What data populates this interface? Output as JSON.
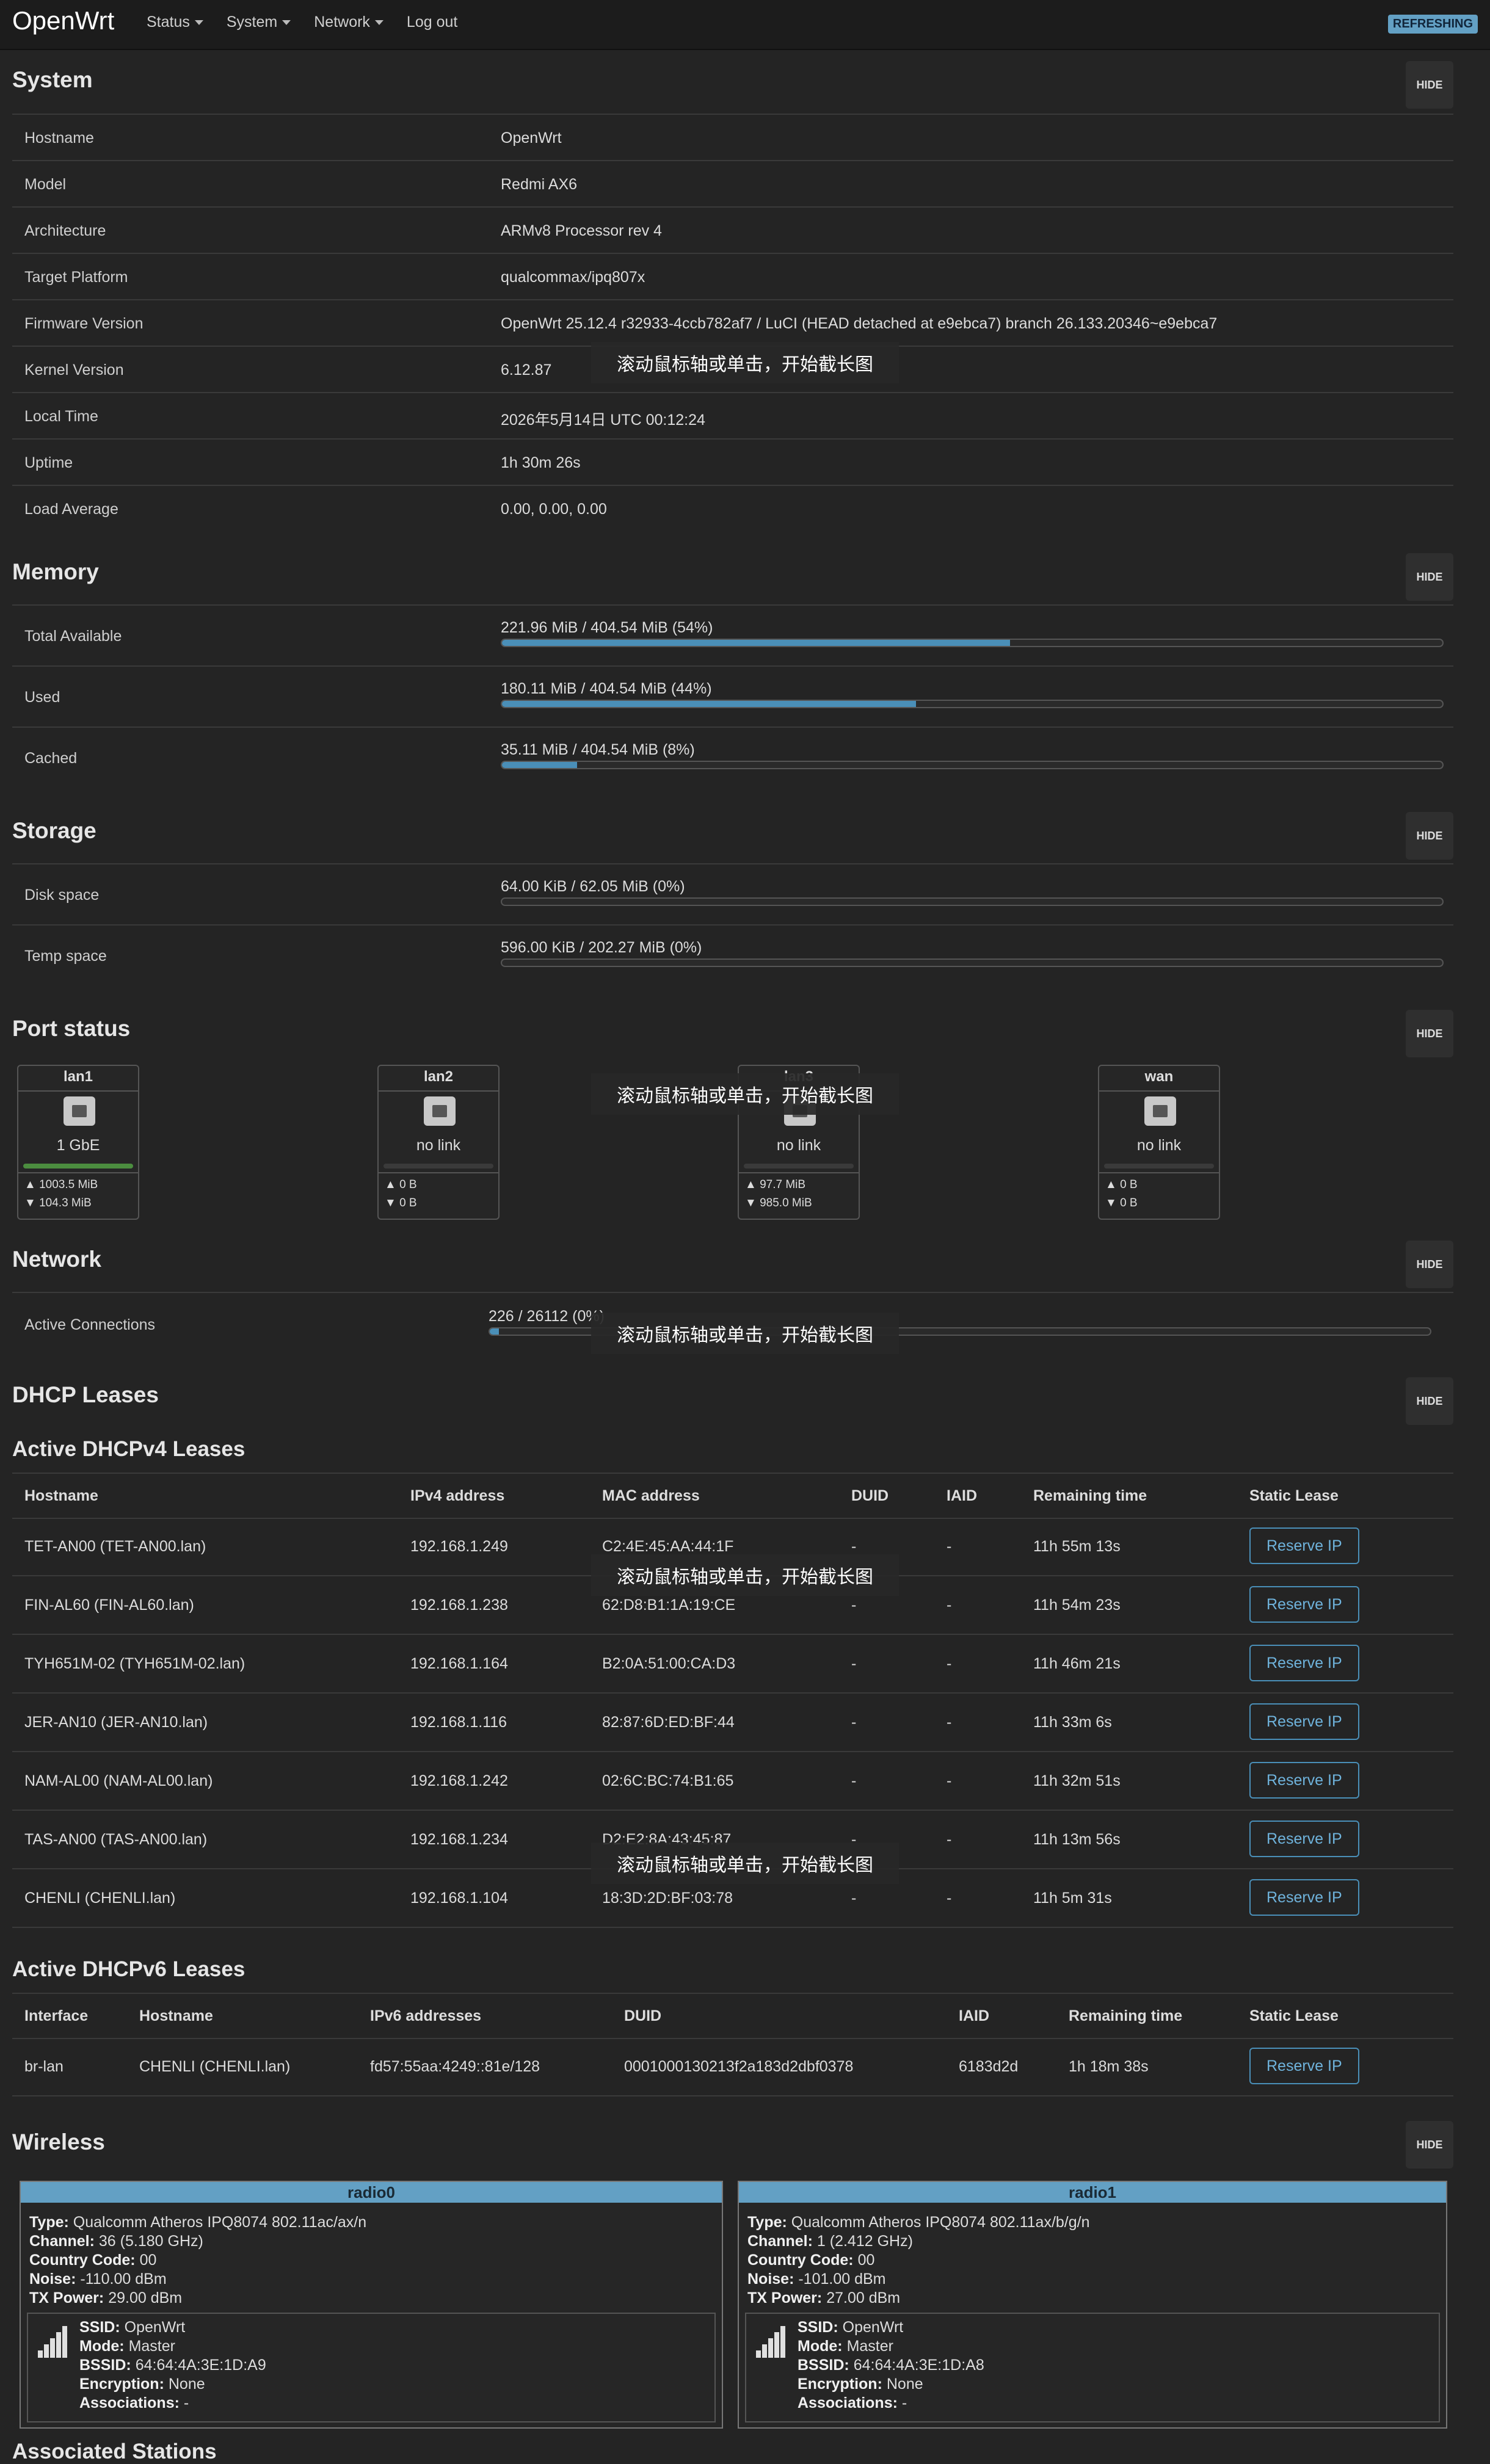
{
  "header": {
    "brand": "OpenWrt",
    "nav": [
      "Status",
      "System",
      "Network",
      "Log out"
    ],
    "refresh_badge": "REFRESHING"
  },
  "hide_label": "HIDE",
  "system": {
    "title": "System",
    "rows": [
      {
        "k": "Hostname",
        "v": "OpenWrt"
      },
      {
        "k": "Model",
        "v": "Redmi AX6"
      },
      {
        "k": "Architecture",
        "v": "ARMv8 Processor rev 4"
      },
      {
        "k": "Target Platform",
        "v": "qualcommax/ipq807x"
      },
      {
        "k": "Firmware Version",
        "v": "OpenWrt 25.12.4 r32933-4ccb782af7 / LuCI (HEAD detached at e9ebca7) branch 26.133.20346~e9ebca7"
      },
      {
        "k": "Kernel Version",
        "v": "6.12.87"
      },
      {
        "k": "Local Time",
        "v": "2026年5月14日 UTC 00:12:24"
      },
      {
        "k": "Uptime",
        "v": "1h 30m 26s"
      },
      {
        "k": "Load Average",
        "v": "0.00, 0.00, 0.00"
      }
    ]
  },
  "memory": {
    "title": "Memory",
    "rows": [
      {
        "k": "Total Available",
        "v": "221.96 MiB / 404.54 MiB (54%)",
        "pct": 54
      },
      {
        "k": "Used",
        "v": "180.11 MiB / 404.54 MiB (44%)",
        "pct": 44
      },
      {
        "k": "Cached",
        "v": "35.11 MiB / 404.54 MiB (8%)",
        "pct": 8
      }
    ]
  },
  "storage": {
    "title": "Storage",
    "rows": [
      {
        "k": "Disk space",
        "v": "64.00 KiB / 62.05 MiB (0%)",
        "pct": 0
      },
      {
        "k": "Temp space",
        "v": "596.00 KiB / 202.27 MiB (0%)",
        "pct": 0
      }
    ]
  },
  "ports": {
    "title": "Port status",
    "items": [
      {
        "name": "lan1",
        "speed": "1 GbE",
        "tx": "▲ 1003.5 MiB",
        "rx": "▼ 104.3 MiB",
        "up": true
      },
      {
        "name": "lan2",
        "speed": "no link",
        "tx": "▲ 0 B",
        "rx": "▼ 0 B",
        "up": false
      },
      {
        "name": "lan3",
        "speed": "no link",
        "tx": "▲ 97.7 MiB",
        "rx": "▼ 985.0 MiB",
        "up": false
      },
      {
        "name": "wan",
        "speed": "no link",
        "tx": "▲ 0 B",
        "rx": "▼ 0 B",
        "up": false
      }
    ]
  },
  "network": {
    "title": "Network",
    "row": {
      "k": "Active Connections",
      "v": "226 / 26112 (0%)",
      "pct": 1
    }
  },
  "dhcp": {
    "title": "DHCP Leases",
    "v4_title": "Active DHCPv4 Leases",
    "v4_headers": [
      "Hostname",
      "IPv4 address",
      "MAC address",
      "DUID",
      "IAID",
      "Remaining time",
      "Static Lease"
    ],
    "v4_rows": [
      [
        "TET-AN00 (TET-AN00.lan)",
        "192.168.1.249",
        "C2:4E:45:AA:44:1F",
        "-",
        "-",
        "11h 55m 13s"
      ],
      [
        "FIN-AL60 (FIN-AL60.lan)",
        "192.168.1.238",
        "62:D8:B1:1A:19:CE",
        "-",
        "-",
        "11h 54m 23s"
      ],
      [
        "TYH651M-02 (TYH651M-02.lan)",
        "192.168.1.164",
        "B2:0A:51:00:CA:D3",
        "-",
        "-",
        "11h 46m 21s"
      ],
      [
        "JER-AN10 (JER-AN10.lan)",
        "192.168.1.116",
        "82:87:6D:ED:BF:44",
        "-",
        "-",
        "11h 33m 6s"
      ],
      [
        "NAM-AL00 (NAM-AL00.lan)",
        "192.168.1.242",
        "02:6C:BC:74:B1:65",
        "-",
        "-",
        "11h 32m 51s"
      ],
      [
        "TAS-AN00 (TAS-AN00.lan)",
        "192.168.1.234",
        "D2:E2:8A:43:45:87",
        "-",
        "-",
        "11h 13m 56s"
      ],
      [
        "CHENLI (CHENLI.lan)",
        "192.168.1.104",
        "18:3D:2D:BF:03:78",
        "-",
        "-",
        "11h 5m 31s"
      ]
    ],
    "reserve_label": "Reserve IP",
    "v6_title": "Active DHCPv6 Leases",
    "v6_headers": [
      "Interface",
      "Hostname",
      "IPv6 addresses",
      "DUID",
      "IAID",
      "Remaining time",
      "Static Lease"
    ],
    "v6_rows": [
      [
        "br-lan",
        "CHENLI (CHENLI.lan)",
        "fd57:55aa:4249::81e/128",
        "0001000130213f2a183d2dbf0378",
        "6183d2d",
        "1h 18m 38s"
      ]
    ]
  },
  "wireless": {
    "title": "Wireless",
    "labels": {
      "type": "Type:",
      "channel": "Channel:",
      "country": "Country Code:",
      "noise": "Noise:",
      "txpower": "TX Power:",
      "ssid": "SSID:",
      "mode": "Mode:",
      "bssid": "BSSID:",
      "enc": "Encryption:",
      "assoc": "Associations:"
    },
    "radios": [
      {
        "name": "radio0",
        "type": "Qualcomm Atheros IPQ8074 802.11ac/ax/n",
        "channel": "36 (5.180 GHz)",
        "country": "00",
        "noise": "-110.00 dBm",
        "txpower": "29.00 dBm",
        "ssid": "OpenWrt",
        "mode": "Master",
        "bssid": "64:64:4A:3E:1D:A9",
        "enc": "None",
        "assoc": "-"
      },
      {
        "name": "radio1",
        "type": "Qualcomm Atheros IPQ8074 802.11ax/b/g/n",
        "channel": "1 (2.412 GHz)",
        "country": "00",
        "noise": "-101.00 dBm",
        "txpower": "27.00 dBm",
        "ssid": "OpenWrt",
        "mode": "Master",
        "bssid": "64:64:4A:3E:1D:A8",
        "enc": "None",
        "assoc": "-"
      }
    ]
  },
  "associated_title": "Associated Stations",
  "overlay_text": "滚动鼠标轴或单击，开始截长图"
}
